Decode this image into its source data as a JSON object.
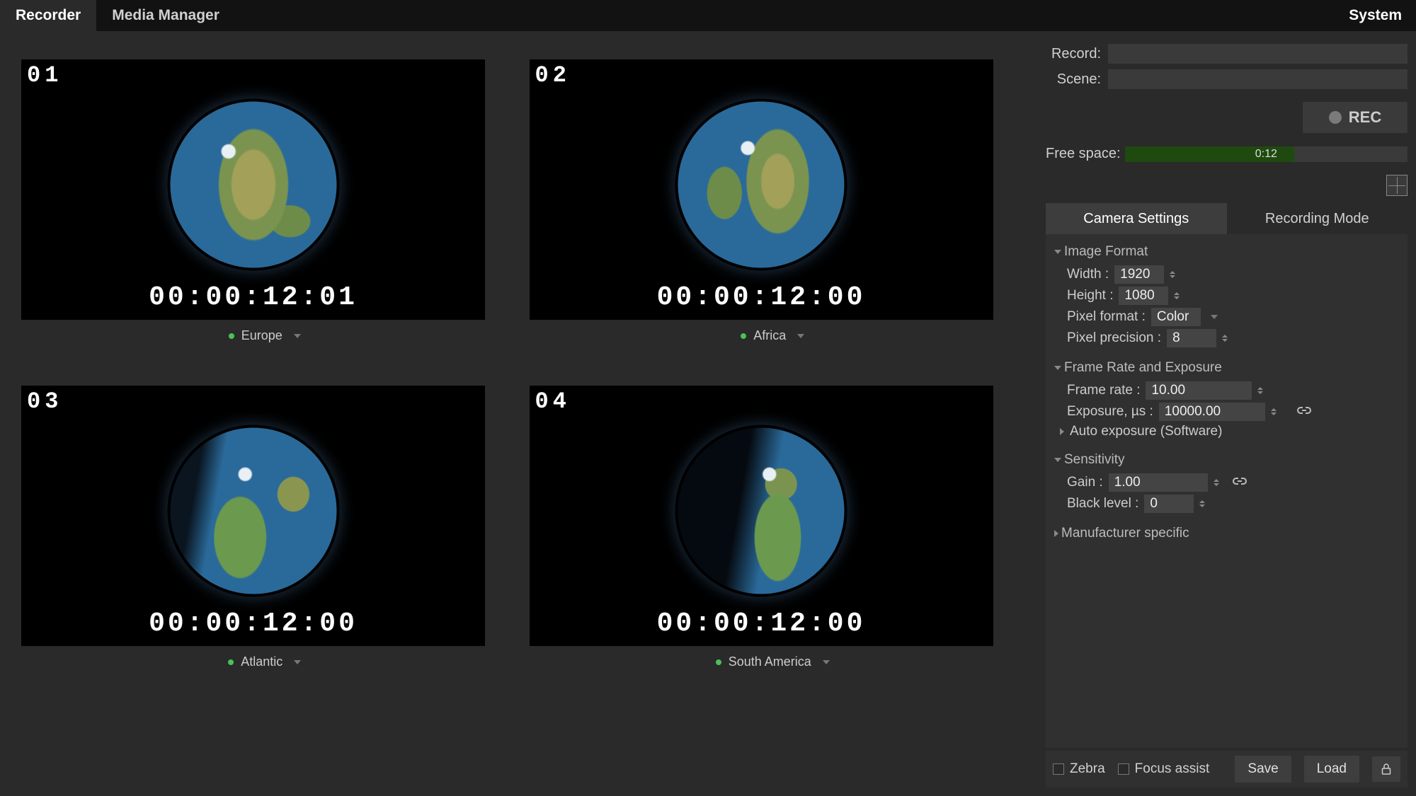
{
  "tabs": {
    "recorder": "Recorder",
    "mediaManager": "Media Manager",
    "system": "System"
  },
  "cameras": [
    {
      "num": "01",
      "tc": "00:00:12:01",
      "name": "Europe"
    },
    {
      "num": "02",
      "tc": "00:00:12:00",
      "name": "Africa"
    },
    {
      "num": "03",
      "tc": "00:00:12:00",
      "name": "Atlantic"
    },
    {
      "num": "04",
      "tc": "00:00:12:00",
      "name": "South America"
    }
  ],
  "side": {
    "recordLabel": "Record:",
    "sceneLabel": "Scene:",
    "recBtn": "REC",
    "freeLabel": "Free space:",
    "freeText": "0:12",
    "freeFillPercent": 60
  },
  "settingsTabs": {
    "camera": "Camera Settings",
    "recording": "Recording Mode"
  },
  "settings": {
    "imageFormat": {
      "title": "Image Format",
      "width": {
        "label": "Width :",
        "value": "1920"
      },
      "height": {
        "label": "Height :",
        "value": "1080"
      },
      "pixelFormat": {
        "label": "Pixel format :",
        "value": "Color"
      },
      "pixelPrecision": {
        "label": "Pixel precision :",
        "value": "8"
      }
    },
    "frameRate": {
      "title": "Frame Rate and Exposure",
      "frameRate": {
        "label": "Frame rate :",
        "value": "10.00"
      },
      "exposure": {
        "label": "Exposure, µs :",
        "value": "10000.00"
      },
      "autoExposure": "Auto exposure (Software)"
    },
    "sensitivity": {
      "title": "Sensitivity",
      "gain": {
        "label": "Gain :",
        "value": "1.00"
      },
      "blackLevel": {
        "label": "Black level :",
        "value": "0"
      }
    },
    "manufacturer": "Manufacturer specific"
  },
  "bottom": {
    "zebra": "Zebra",
    "focusAssist": "Focus assist",
    "save": "Save",
    "load": "Load"
  }
}
